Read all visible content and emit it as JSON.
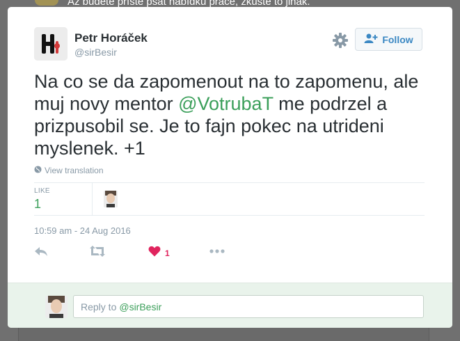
{
  "background": {
    "partial_text": "Až budete příště psát nabídku práce, zkuste to jinak."
  },
  "author": {
    "name": "Petr Horáček",
    "handle": "@sirBesir"
  },
  "follow_button": {
    "label": "Follow"
  },
  "tweet": {
    "text_before": "Na co se da zapomenout na to zapomenu, ale muj novy mentor ",
    "mention": "@VotrubaT",
    "text_after": " me podrzel a prizpusobil se. Je to fajn pokec na utrideni myslenek. +1",
    "translate_label": "View translation",
    "likes_label": "LIKE",
    "likes_count": "1",
    "timestamp": "10:59 am - 24 Aug 2016"
  },
  "actions": {
    "like_count": "1"
  },
  "reply": {
    "prefix": "Reply to",
    "mention": "@sirBesir"
  },
  "colors": {
    "accent": "#3b9f5a",
    "like": "#e0245e",
    "muted": "#8899a6",
    "follow": "#3b88c3"
  },
  "icons": [
    "settings-gear-icon",
    "follow-person-plus-icon",
    "globe-icon",
    "reply-icon",
    "retweet-icon",
    "heart-icon",
    "more-icon"
  ]
}
